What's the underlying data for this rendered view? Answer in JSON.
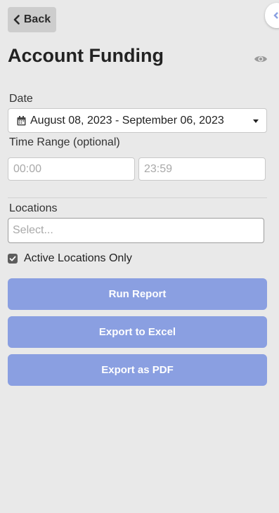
{
  "header": {
    "back_label": "Back",
    "title": "Account Funding"
  },
  "date": {
    "label": "Date",
    "range": "August 08, 2023 - September 06, 2023"
  },
  "time_range": {
    "label": "Time Range (optional)",
    "start_placeholder": "00:00",
    "end_placeholder": "23:59"
  },
  "locations": {
    "label": "Locations",
    "placeholder": "Select...",
    "active_only_label": "Active Locations Only",
    "active_only_checked": true
  },
  "actions": {
    "run_report": "Run Report",
    "export_excel": "Export to Excel",
    "export_pdf": "Export as PDF"
  },
  "colors": {
    "background": "#e9e9e9",
    "button": "#8a9fe1",
    "back_button": "#cdcdcd"
  },
  "icons": [
    "chevron-left-icon",
    "eye-icon",
    "calendar-icon",
    "caret-down-icon",
    "checkmark-icon"
  ]
}
